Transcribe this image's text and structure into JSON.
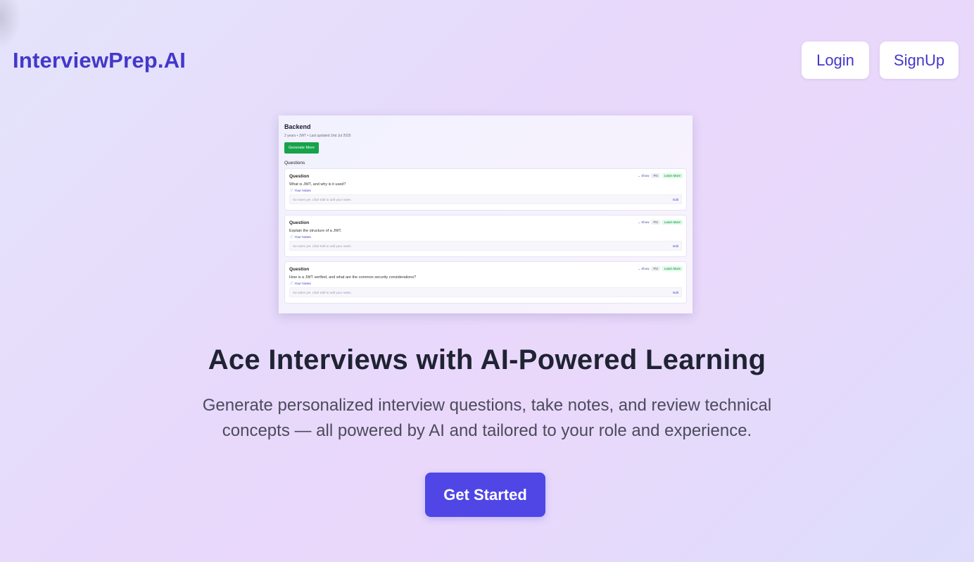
{
  "header": {
    "brand": "InterviewPrep.AI",
    "login_label": "Login",
    "signup_label": "SignUp"
  },
  "preview": {
    "title": "Backend",
    "meta": "2 years • JWT • Last updated 2nd Jul 2025",
    "generate_label": "Generate More",
    "questions_heading": "Questions",
    "cards": [
      {
        "heading": "Question",
        "text": "What is JWT, and why is it used?",
        "show": "⌄ Show",
        "pin": "Pin",
        "learn": "Learn More",
        "notes_label": "📄 Your Notes",
        "notes_placeholder": "No notes yet. Click Edit to add your notes.",
        "edit": "Edit"
      },
      {
        "heading": "Question",
        "text": "Explain the structure of a JWT.",
        "show": "⌄ Show",
        "pin": "Pin",
        "learn": "Learn More",
        "notes_label": "📄 Your Notes",
        "notes_placeholder": "No notes yet. Click Edit to add your notes.",
        "edit": "Edit"
      },
      {
        "heading": "Question",
        "text": "How is a JWT verified, and what are the common security considerations?",
        "show": "⌄ Show",
        "pin": "Pin",
        "learn": "Learn More",
        "notes_label": "📄 Your Notes",
        "notes_placeholder": "No notes yet. Click Edit to add your notes.",
        "edit": "Edit"
      }
    ]
  },
  "hero": {
    "headline": "Ace Interviews with AI-Powered Learning",
    "subtext": "Generate personalized interview questions, take notes, and review technical concepts — all powered by AI and tailored to your role and experience.",
    "cta_label": "Get Started"
  },
  "colors": {
    "brand": "#4338ca",
    "cta": "#4f46e5",
    "generate": "#16a34a"
  }
}
